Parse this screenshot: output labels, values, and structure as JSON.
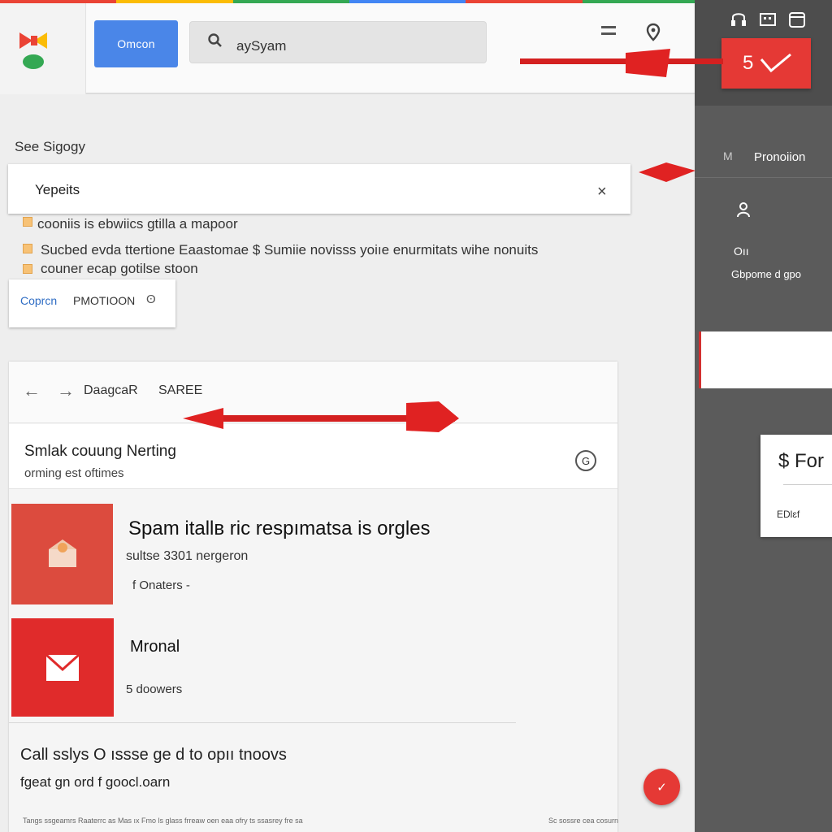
{
  "colors": {
    "accent_blue": "#4a86e8",
    "brand_red": "#e53935",
    "panel_dark": "#5b5b5b",
    "strip": [
      "#ea4335",
      "#fbbc05",
      "#34a853",
      "#4285f4",
      "#ea4335",
      "#34a853"
    ]
  },
  "header": {
    "primary_button": "Omcon",
    "search_text": "aySyam",
    "search_icon": "search-icon",
    "menu_icon": "menu-icon",
    "pin_icon": "location-pin-icon"
  },
  "right_panel": {
    "badge": "5",
    "badge_icon": "check-icon",
    "promo_label": "Pronoiion",
    "promo_icon": "M",
    "line1": "Oıı",
    "line2": "Gbpome d gpo",
    "card_title": "$ For",
    "card_sub": "EDlɛf"
  },
  "section": {
    "title": "See Sigogy",
    "notice_title": "Yepeits",
    "notice_close": "×",
    "lines": [
      "cooniis is ebwiics gtilla a mapoor",
      "Sucbed evda ttertione Eaastomae $ Sumiie novisss yoiıe enurmitats wihe nonuits",
      "couner ecap gotilse stoon"
    ],
    "promo_link1": "Coprcn",
    "promo_link2": "PMOTIOON",
    "promo_icon": "ʘ"
  },
  "mail": {
    "toolbar_label": "DaagcaR",
    "toolbar_label2": "SAREE",
    "subject": "Smlak couung Nerting",
    "subject_sub": "orming est oftimes",
    "subject_icon": "G",
    "messages": [
      {
        "title": "Spam itallв ric respımatsa is orgles",
        "sub": "sultse 3301 nergeron",
        "meta": "f Onaters -"
      },
      {
        "title": "Mronal",
        "meta": "5  doowers"
      }
    ],
    "footer_line1": "Call sslys O ıssse ge d to opıı tnoovs",
    "footer_line2": "fgeat gn ord f goocl.oarn",
    "fineprint": "Tangs ssgeamrs Raaterrc as Mas ıx Fmo ls glass frreaw oen eaa ofry ts ssasrey fre sa",
    "fineprint2": "Sc sossre cea cosurn",
    "fab": "✓"
  }
}
